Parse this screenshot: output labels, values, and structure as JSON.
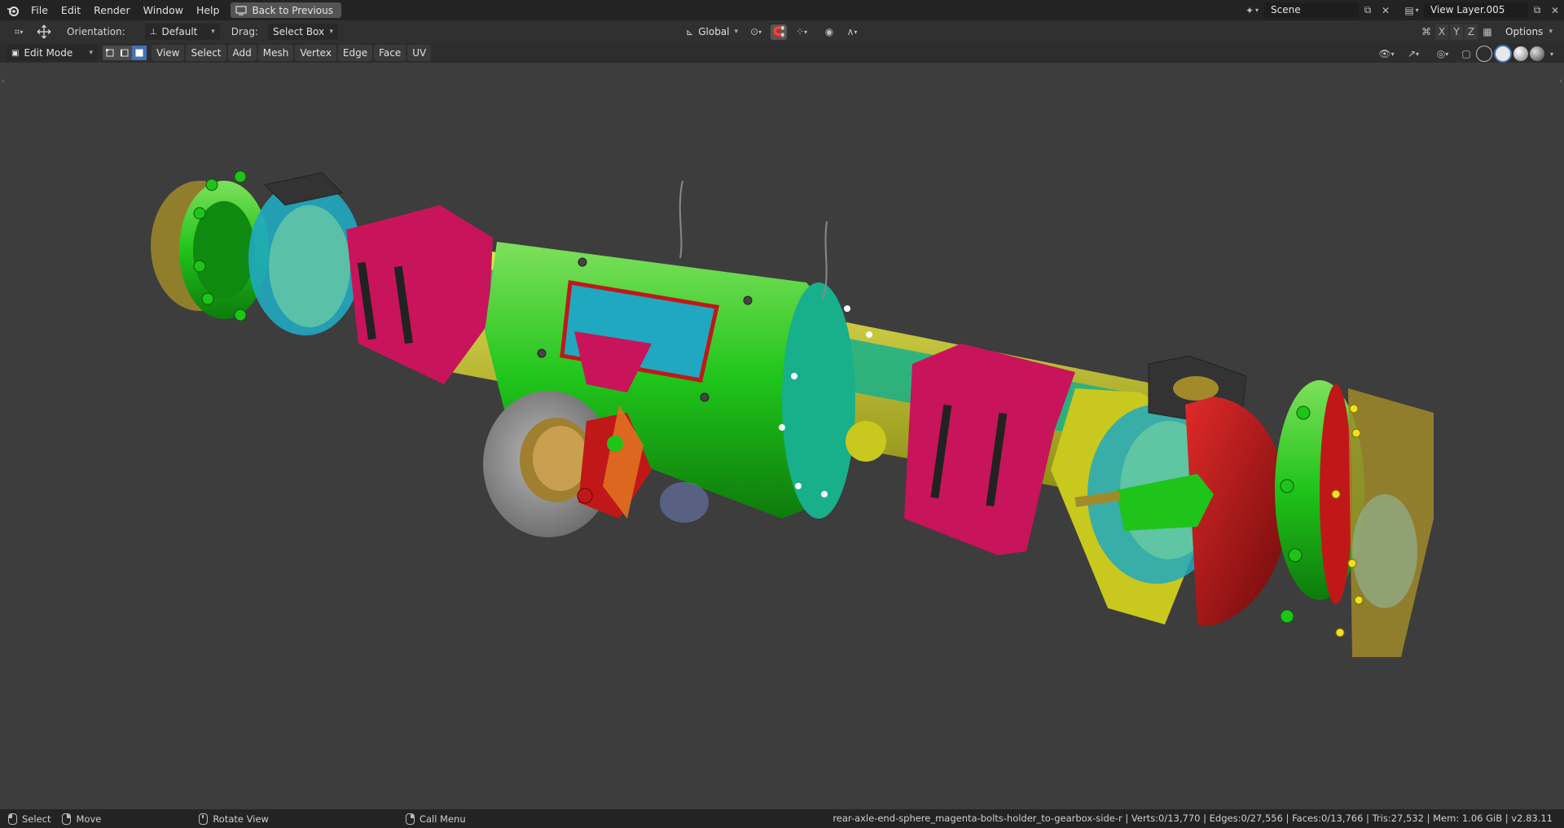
{
  "topbar": {
    "menus": [
      "File",
      "Edit",
      "Render",
      "Window",
      "Help"
    ],
    "back_button": "Back to Previous",
    "scene": "Scene",
    "view_layer": "View Layer.005"
  },
  "toolbar": {
    "orientation_label": "Orientation:",
    "orientation_value": "Default",
    "drag_label": "Drag:",
    "drag_value": "Select Box",
    "transform_orientation": "Global",
    "axes": [
      "X",
      "Y",
      "Z"
    ],
    "options": "Options"
  },
  "header": {
    "mode": "Edit Mode",
    "menus": [
      "View",
      "Select",
      "Add",
      "Mesh",
      "Vertex",
      "Edge",
      "Face",
      "UV"
    ]
  },
  "statusbar": {
    "select": "Select",
    "move": "Move",
    "rotate": "Rotate View",
    "call_menu": "Call Menu",
    "info": "rear-axle-end-sphere_magenta-bolts-holder_to-gearbox-side-r | Verts:0/13,770 | Edges:0/27,556 | Faces:0/13,766 | Tris:27,532 | Mem: 1.06 GiB | v2.83.11"
  },
  "colors": {
    "green": "#1fc41a",
    "teal": "#17b08a",
    "cyan": "#20a8c0",
    "yellow": "#c8c81e",
    "magenta": "#c8145a",
    "red": "#c01818",
    "brass": "#a08a2a",
    "grey": "#9a9a9a"
  }
}
